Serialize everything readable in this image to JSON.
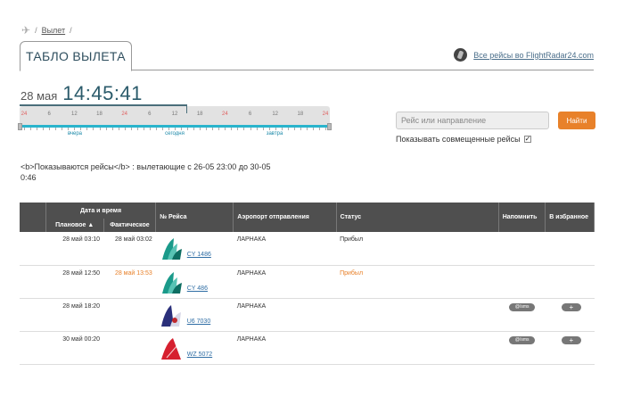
{
  "breadcrumb": {
    "link": "Вылет",
    "separator": "/"
  },
  "tab_title": "ТАБЛО ВЫЛЕТА",
  "flightradar_link": "Все рейсы во FlightRadar24.com",
  "clock": {
    "date": "28 мая",
    "time": "14:45:41"
  },
  "timeline": {
    "ticks": [
      "24",
      "6",
      "12",
      "18",
      "24",
      "6",
      "12",
      "18",
      "24",
      "6",
      "12",
      "18",
      "24"
    ],
    "day_labels": [
      "вчера",
      "сегодня",
      "завтра"
    ]
  },
  "search": {
    "placeholder": "Рейс или направление",
    "button": "Найти"
  },
  "codeshare": {
    "label": "Показывать совмещенные рейсы",
    "checked": "✓"
  },
  "summary": "<b>Показываются рейсы</b> : вылетающие с 26-05 23:00 до 30-05 0:46",
  "table": {
    "headers": {
      "datetime": "Дата и время",
      "planned": "Плановое ▲",
      "actual": "Фактическое",
      "flight": "№ Рейса",
      "airport": "Аэропорт отправления",
      "status": "Статус",
      "remind": "Напомнить",
      "favorite": "В избранное"
    },
    "rows": [
      {
        "planned": "28 май  03:10",
        "actual": "28 май 03:02",
        "actual_late": false,
        "flight": "CY 1486",
        "logo": "cyprus-airways",
        "airport": "ЛАРНАКА",
        "status": "Прибыл",
        "status_late": false,
        "remind": "",
        "fav": ""
      },
      {
        "planned": "28 май  12:50",
        "actual": "28 май 13:53",
        "actual_late": true,
        "flight": "CY 486",
        "logo": "cyprus-airways",
        "airport": "ЛАРНАКА",
        "status": "Прибыл",
        "status_late": true,
        "remind": "",
        "fav": ""
      },
      {
        "planned": "28 май  18:20",
        "actual": "",
        "actual_late": false,
        "flight": "U6 7030",
        "logo": "ural-airlines",
        "airport": "ЛАРНАКА",
        "status": "",
        "status_late": false,
        "remind": "@/sms",
        "fav": "+"
      },
      {
        "planned": "30 май  00:20",
        "actual": "",
        "actual_late": false,
        "flight": "WZ 5072",
        "logo": "red-wings",
        "airport": "ЛАРНАКА",
        "status": "",
        "status_late": false,
        "remind": "@/sms",
        "fav": "+"
      }
    ]
  },
  "colors": {
    "accent": "#e8812a",
    "header_bg": "#4f4f4f",
    "timeline_bar": "#2ab4cc",
    "link": "#2e6da4"
  }
}
